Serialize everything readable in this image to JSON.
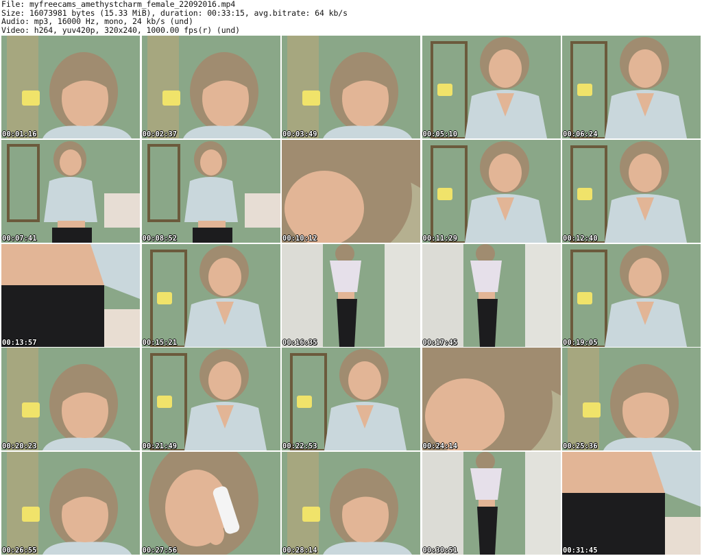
{
  "header": {
    "file_line": "File: myfreecams_amethystcharm_female_22092016.mp4",
    "size_line": "Size: 16073981 bytes (15.33 MiB), duration: 00:33:15, avg.bitrate: 64 kb/s",
    "audio_line": "Audio: mp3, 16000 Hz, mono, 24 kb/s (und)",
    "video_line": "Video: h264, yuv420p, 320x240, 1000.00 fps(r) (und)"
  },
  "thumbnails": [
    {
      "timestamp": "00:01:16",
      "scene": "face"
    },
    {
      "timestamp": "00:02:37",
      "scene": "face"
    },
    {
      "timestamp": "00:03:49",
      "scene": "face"
    },
    {
      "timestamp": "00:05:10",
      "scene": "torso"
    },
    {
      "timestamp": "00:06:24",
      "scene": "torso"
    },
    {
      "timestamp": "00:07:41",
      "scene": "wide"
    },
    {
      "timestamp": "00:08:52",
      "scene": "wide"
    },
    {
      "timestamp": "00:10:12",
      "scene": "closeup"
    },
    {
      "timestamp": "00:11:29",
      "scene": "torso"
    },
    {
      "timestamp": "00:12:40",
      "scene": "torso"
    },
    {
      "timestamp": "00:13:57",
      "scene": "waist"
    },
    {
      "timestamp": "00:15:21",
      "scene": "torso"
    },
    {
      "timestamp": "00:16:35",
      "scene": "standing"
    },
    {
      "timestamp": "00:17:45",
      "scene": "standing"
    },
    {
      "timestamp": "00:19:05",
      "scene": "torso"
    },
    {
      "timestamp": "00:20:23",
      "scene": "face"
    },
    {
      "timestamp": "00:21:49",
      "scene": "torso"
    },
    {
      "timestamp": "00:22:53",
      "scene": "torso"
    },
    {
      "timestamp": "00:24:14",
      "scene": "closeup"
    },
    {
      "timestamp": "00:25:36",
      "scene": "face"
    },
    {
      "timestamp": "00:26:55",
      "scene": "face"
    },
    {
      "timestamp": "00:27:56",
      "scene": "phone"
    },
    {
      "timestamp": "00:28:14",
      "scene": "face"
    },
    {
      "timestamp": "00:30:51",
      "scene": "standing"
    },
    {
      "timestamp": "00:31:45",
      "scene": "waist"
    }
  ],
  "colors": {
    "wall": "#8aa788",
    "hair": "#a08c70",
    "skin": "#e2b596",
    "shirt": "#c9d7dc",
    "lamp": "#f0e36a",
    "pants": "#1c1c1e",
    "frame": "#6b5a3c"
  }
}
